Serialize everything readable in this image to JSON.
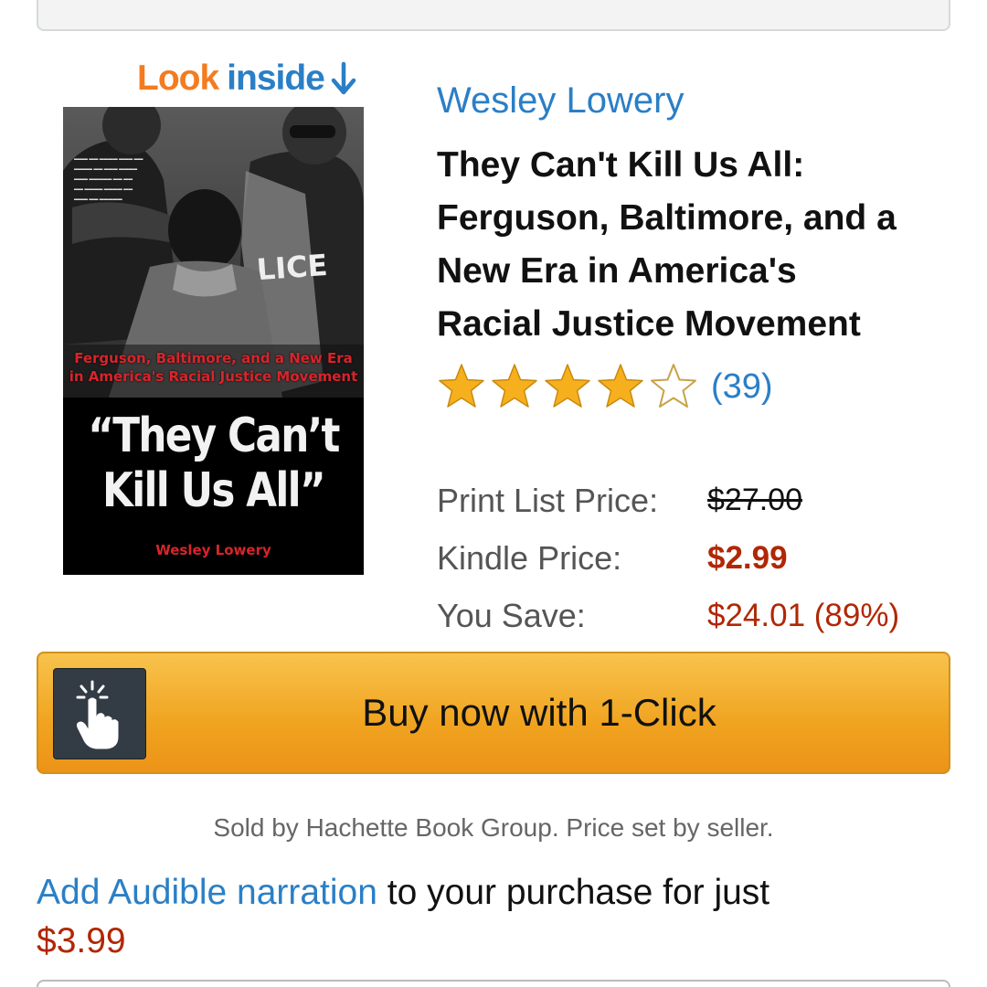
{
  "look_inside": {
    "look": "Look",
    "inside": "inside"
  },
  "cover": {
    "subtitle_line1": "Ferguson, Baltimore, and a New Era",
    "subtitle_line2": "in America's Racial Justice Movement",
    "title_line1": "“They Can’t",
    "title_line2": "Kill Us All”",
    "author": "Wesley Lowery",
    "police_text": "LICE"
  },
  "product": {
    "author": "Wesley Lowery",
    "title_lines": [
      "They Can't Kill Us All:",
      "Ferguson, Baltimore, and a",
      "New Era in America's",
      "Racial Justice Movement"
    ],
    "rating_stars": 4,
    "rating_max": 5,
    "review_count": "(39)"
  },
  "pricing": {
    "list_label": "Print List Price:",
    "list_value": "$27.00",
    "kindle_label": "Kindle Price:",
    "kindle_value": "$2.99",
    "save_label": "You Save:",
    "save_value": "$24.01 (89%)"
  },
  "buy_button": {
    "label": "Buy now with 1-Click"
  },
  "seller_note": "Sold by Hachette Book Group. Price set by seller.",
  "audible": {
    "link": "Add Audible narration",
    "text": " to your purchase for just",
    "price": "$3.99"
  },
  "colors": {
    "link": "#2a7fc6",
    "price_red": "#b12704",
    "look_orange": "#f47b20",
    "button_orange": "#f0a31f",
    "star_gold": "#f6b01e"
  }
}
